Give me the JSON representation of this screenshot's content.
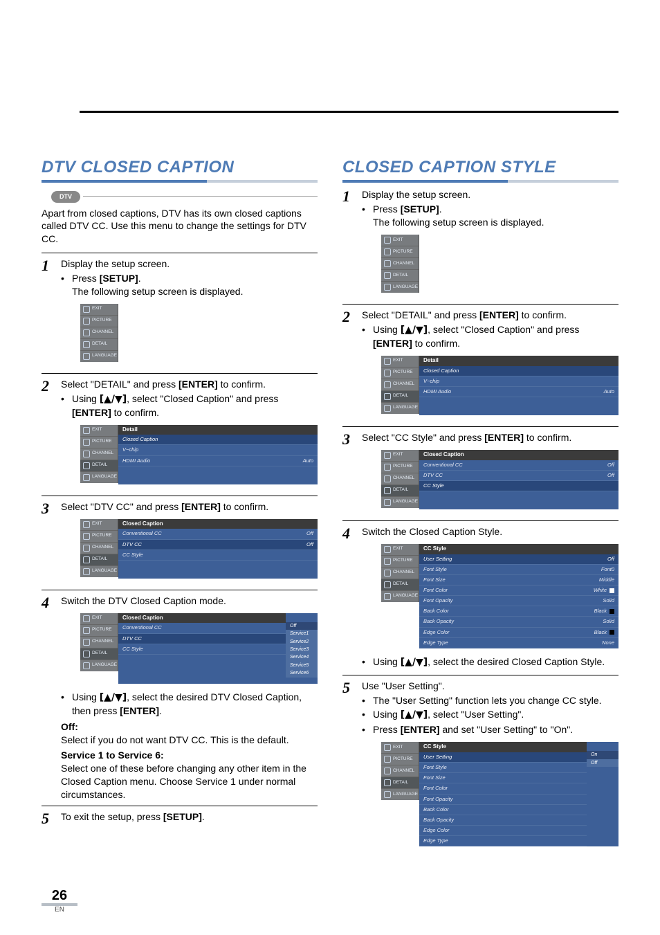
{
  "page": {
    "number": "26",
    "lang_code": "EN"
  },
  "osd_sidebar": {
    "items": [
      "EXIT",
      "PICTURE",
      "CHANNEL",
      "DETAIL",
      "LANGUAGE"
    ]
  },
  "left": {
    "heading": "DTV CLOSED CAPTION",
    "dtv_tag": "DTV",
    "intro": "Apart from closed captions, DTV has its own closed captions called DTV CC. Use this menu to change the settings for DTV CC.",
    "step1": {
      "text": "Display the setup screen.",
      "b1a": "Press ",
      "b1b": "[SETUP]",
      "b1c": ".",
      "b1sub": "The following setup screen is displayed."
    },
    "step2": {
      "a": "Select \"DETAIL\" and press ",
      "b": "[ENTER]",
      "c": " to confirm.",
      "bul_a": "Using ",
      "bul_b": "[▲/▼]",
      "bul_c": ", select \"Closed Caption\" and press ",
      "bul_d": "[ENTER]",
      "bul_e": " to confirm.",
      "osd_title": "Detail",
      "osd_rows": [
        {
          "label": "Closed Caption",
          "val": "",
          "hl": true
        },
        {
          "label": "V−chip",
          "val": ""
        },
        {
          "label": "HDMI Audio",
          "val": "Auto"
        }
      ]
    },
    "step3": {
      "a": "Select \"DTV CC\" and press ",
      "b": "[ENTER]",
      "c": " to confirm.",
      "osd_title": "Closed Caption",
      "osd_rows": [
        {
          "label": "Conventional CC",
          "val": "Off"
        },
        {
          "label": "DTV CC",
          "val": "Off",
          "hl": true
        },
        {
          "label": "CC Style",
          "val": ""
        }
      ]
    },
    "step4": {
      "text": "Switch the DTV Closed Caption mode.",
      "osd_title": "Closed Caption",
      "osd_rows": [
        {
          "label": "Conventional CC",
          "val": ""
        },
        {
          "label": "DTV CC",
          "val": "",
          "hl": true
        },
        {
          "label": "CC Style",
          "val": ""
        }
      ],
      "osd_options": [
        "Off",
        "Service1",
        "Service2",
        "Service3",
        "Service4",
        "Service5",
        "Service6"
      ],
      "bul_a": "Using ",
      "bul_b": "[▲/▼]",
      "bul_c": ", select the desired DTV Closed Caption, then press ",
      "bul_d": "[ENTER]",
      "bul_e": ".",
      "off_h": "Off:",
      "off_t": "Select if you do not want DTV CC. This is the default.",
      "svc_h": "Service 1 to Service 6:",
      "svc_t": "Select one of these before changing any other item in the Closed Caption menu. Choose Service 1 under normal circumstances."
    },
    "step5": {
      "a": "To exit the setup, press ",
      "b": "[SETUP]",
      "c": "."
    }
  },
  "right": {
    "heading": "CLOSED CAPTION STYLE",
    "step1": {
      "text": "Display the setup screen.",
      "b1a": "Press ",
      "b1b": "[SETUP]",
      "b1c": ".",
      "b1sub": "The following setup screen is displayed."
    },
    "step2": {
      "a": "Select \"DETAIL\" and press ",
      "b": "[ENTER]",
      "c": " to confirm.",
      "bul_a": "Using ",
      "bul_b": "[▲/▼]",
      "bul_c": ", select \"Closed Caption\" and press ",
      "bul_d": "[ENTER]",
      "bul_e": " to confirm.",
      "osd_title": "Detail",
      "osd_rows": [
        {
          "label": "Closed Caption",
          "val": "",
          "hl": true
        },
        {
          "label": "V−chip",
          "val": ""
        },
        {
          "label": "HDMI Audio",
          "val": "Auto"
        }
      ]
    },
    "step3": {
      "a": "Select \"CC Style\" and press  ",
      "b": "[ENTER]",
      "c": " to confirm.",
      "osd_title": "Closed Caption",
      "osd_rows": [
        {
          "label": "Conventional CC",
          "val": "Off"
        },
        {
          "label": "DTV CC",
          "val": "Off"
        },
        {
          "label": "CC Style",
          "val": "",
          "hl": true
        }
      ]
    },
    "step4": {
      "text": "Switch the Closed Caption Style.",
      "osd_title": "CC Style",
      "osd_rows": [
        {
          "label": "User Setting",
          "val": "Off",
          "hl": true
        },
        {
          "label": "Font Style",
          "val": "Font0"
        },
        {
          "label": "Font Size",
          "val": "Middle"
        },
        {
          "label": "Font Color",
          "val": "White",
          "swatch": "#ffffff"
        },
        {
          "label": "Font Opacity",
          "val": "Solid"
        },
        {
          "label": "Back Color",
          "val": "Black",
          "swatch": "#000000"
        },
        {
          "label": "Back Opacity",
          "val": "Solid"
        },
        {
          "label": "Edge Color",
          "val": "Black",
          "swatch": "#000000"
        },
        {
          "label": "Edge Type",
          "val": "None"
        }
      ],
      "bul_a": "Using ",
      "bul_b": "[▲/▼]",
      "bul_c": ", select the desired Closed Caption Style."
    },
    "step5": {
      "text": "Use \"User Setting\".",
      "b1": "The \"User Setting\" function lets you change CC style.",
      "b2a": "Using ",
      "b2b": "[▲/▼]",
      "b2c": ", select \"User Setting\".",
      "b3a": "Press ",
      "b3b": "[ENTER]",
      "b3c": " and set \"User Setting\" to \"On\".",
      "osd_title": "CC Style",
      "osd_rows": [
        {
          "label": "User Setting",
          "val": "",
          "hl": true
        },
        {
          "label": "Font Style",
          "val": ""
        },
        {
          "label": "Font Size",
          "val": ""
        },
        {
          "label": "Font Color",
          "val": ""
        },
        {
          "label": "Font Opacity",
          "val": ""
        },
        {
          "label": "Back Color",
          "val": ""
        },
        {
          "label": "Back Opacity",
          "val": ""
        },
        {
          "label": "Edge Color",
          "val": ""
        },
        {
          "label": "Edge Type",
          "val": ""
        }
      ],
      "osd_opts": [
        "On",
        "Off"
      ]
    }
  }
}
